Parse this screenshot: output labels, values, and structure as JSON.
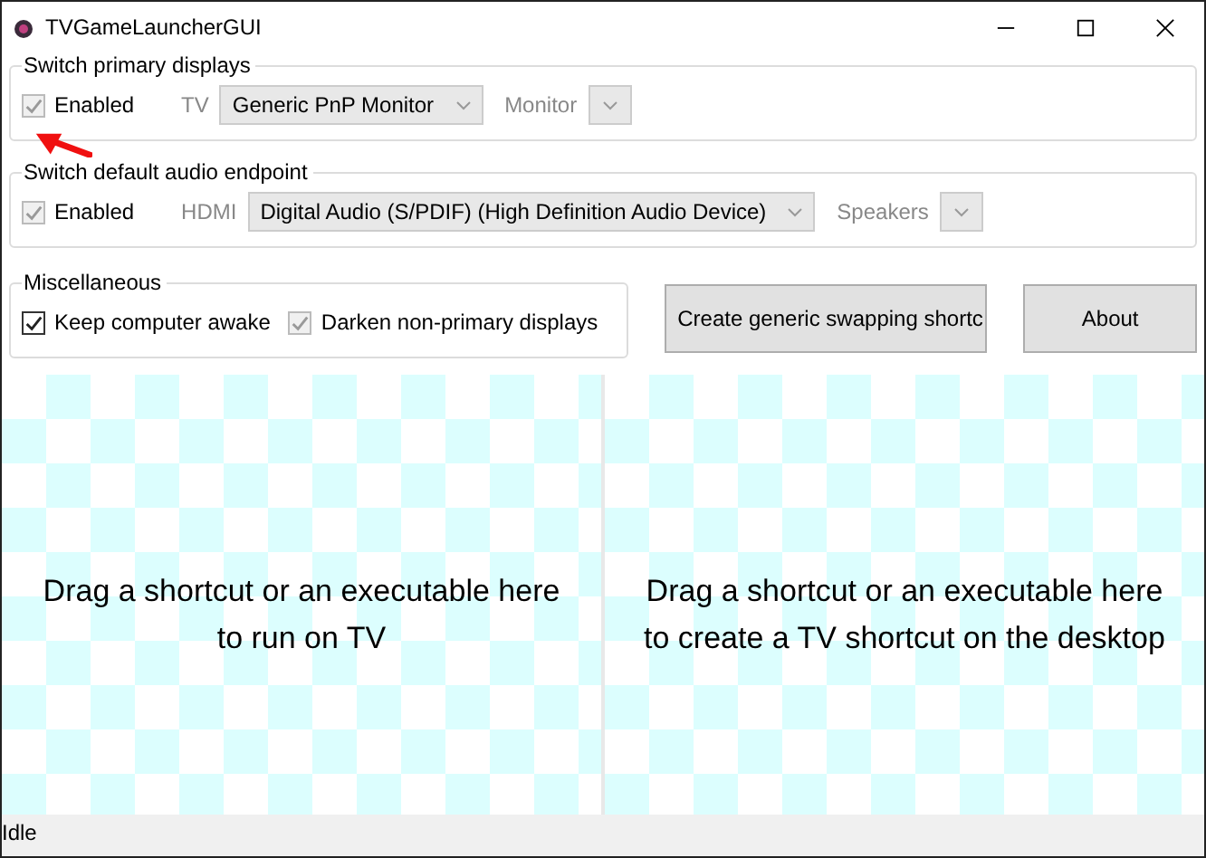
{
  "window": {
    "title": "TVGameLauncherGUI"
  },
  "groups": [
    {
      "title": "Switch primary displays",
      "enabled": {
        "label": "Enabled",
        "checked": true,
        "disabled": true
      },
      "fields": [
        {
          "label": "TV",
          "value": "Generic PnP Monitor"
        },
        {
          "label": "Monitor"
        }
      ]
    },
    {
      "title": "Switch default audio endpoint",
      "enabled": {
        "label": "Enabled",
        "checked": true,
        "disabled": true
      },
      "fields": [
        {
          "label": "HDMI",
          "value": "Digital Audio (S/PDIF) (High Definition Audio Device)"
        },
        {
          "label": "Speakers"
        }
      ]
    }
  ],
  "miscellaneous": {
    "title": "Miscellaneous",
    "options": [
      {
        "label": "Keep computer awake",
        "checked": true,
        "disabled": false
      },
      {
        "label": "Darken non-primary displays",
        "checked": true,
        "disabled": true
      }
    ]
  },
  "buttons": [
    "Create generic swapping shortc",
    "About"
  ],
  "drop_zones": [
    "Drag a shortcut or an executable here\nto run on TV",
    "Drag a shortcut or an executable here\nto create a TV shortcut on the desktop"
  ],
  "status_bar": "Idle"
}
